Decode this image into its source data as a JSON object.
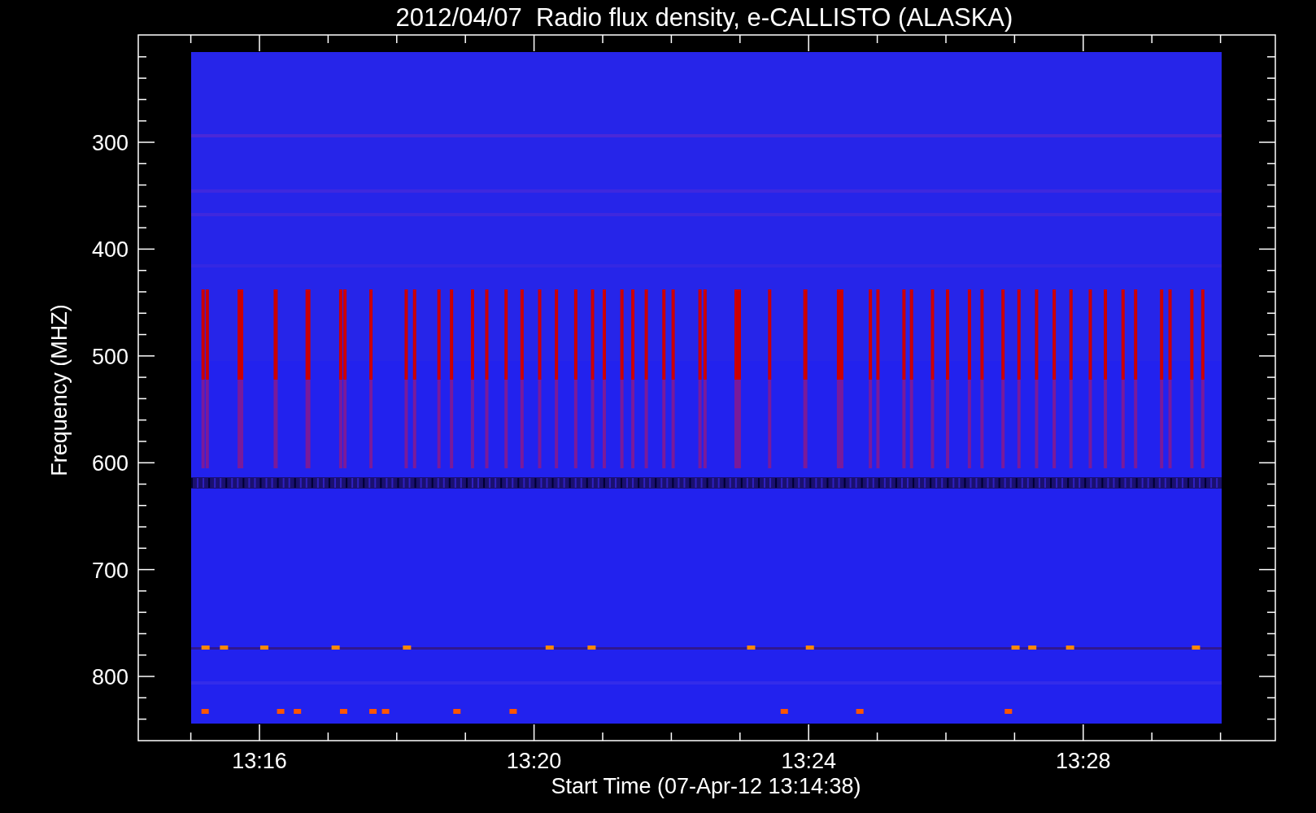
{
  "title": "2012/04/07  Radio flux density, e-CALLISTO (ALASKA)",
  "y_axis": {
    "label": "Frequency (MHZ)",
    "ticks": [
      "300",
      "400",
      "500",
      "600",
      "700",
      "800"
    ]
  },
  "x_axis": {
    "label": "Start Time (07-Apr-12 13:14:38)",
    "ticks": [
      "13:16",
      "13:20",
      "13:24",
      "13:28"
    ]
  }
}
